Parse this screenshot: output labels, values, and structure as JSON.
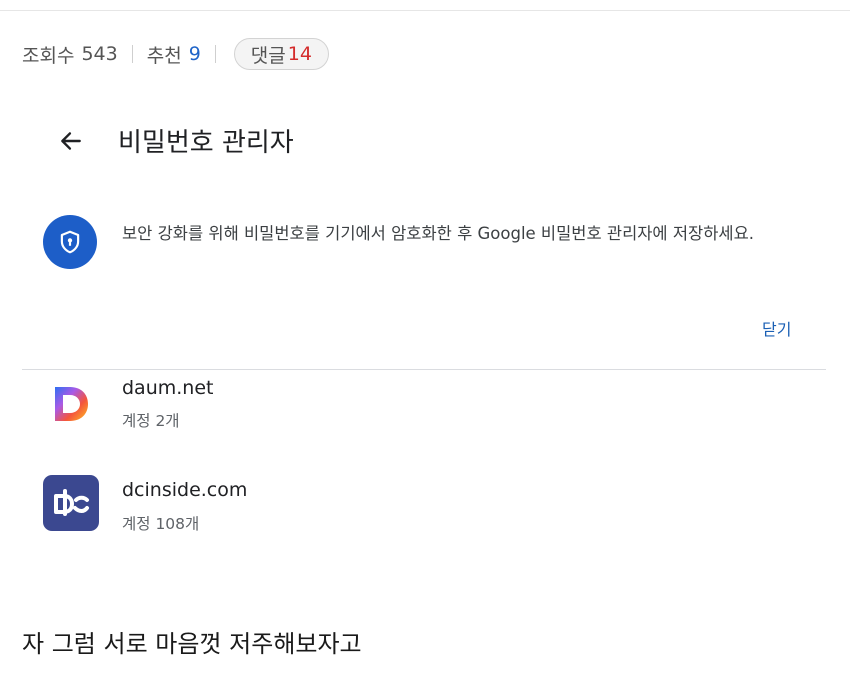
{
  "post_meta": {
    "views_label": "조회수",
    "views_value": "543",
    "recommend_label": "추천",
    "recommend_value": "9",
    "comments_label": "댓글",
    "comments_value": "14"
  },
  "password_manager": {
    "title": "비밀번호 관리자",
    "banner_text": "보안 강화를 위해 비밀번호를 기기에서 암호화한 후 Google 비밀번호 관리자에 저장하세요.",
    "close_label": "닫기",
    "sites": [
      {
        "name": "daum.net",
        "accounts": "계정 2개",
        "icon": "daum-logo-icon"
      },
      {
        "name": "dcinside.com",
        "accounts": "계정 108개",
        "icon": "dcinside-logo-icon"
      }
    ]
  },
  "caption": "자 그럼 서로 마음껏 저주해보자고",
  "colors": {
    "accent_blue": "#1d5ec8",
    "link_blue": "#1a5fb4",
    "count_red": "#d42c2c",
    "dcinside_bg": "#3b4890"
  }
}
